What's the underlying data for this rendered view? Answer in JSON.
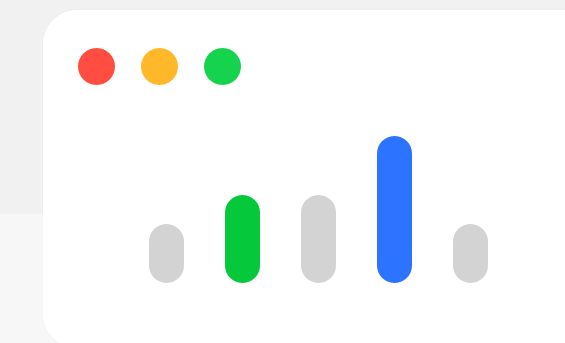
{
  "window": {
    "controls": [
      {
        "name": "close",
        "color": "#ff4e41"
      },
      {
        "name": "minimize",
        "color": "#ffb829"
      },
      {
        "name": "maximize",
        "color": "#16d34d"
      }
    ]
  },
  "chart_data": {
    "type": "bar",
    "categories": [
      "",
      "",
      "",
      "",
      ""
    ],
    "values": [
      2,
      3,
      3,
      5,
      2
    ],
    "colors": [
      "#d3d3d3",
      "#06c83b",
      "#d3d3d3",
      "#2c73ff",
      "#d3d3d3"
    ],
    "title": "",
    "xlabel": "",
    "ylabel": "",
    "ylim": [
      0,
      5
    ]
  }
}
